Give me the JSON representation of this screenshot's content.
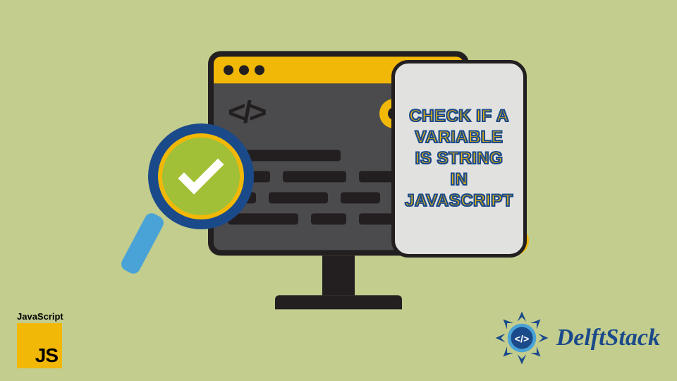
{
  "panel": {
    "text": "CHECK IF A VARIABLE IS STRING IN JAVASCRIPT"
  },
  "js_badge": {
    "label": "JavaScript",
    "short": "JS"
  },
  "brand": {
    "name": "DelftStack"
  },
  "colors": {
    "bg": "#c3cd8e",
    "accent": "#f2b807",
    "dark": "#231f20",
    "blue": "#1b4a8a"
  }
}
